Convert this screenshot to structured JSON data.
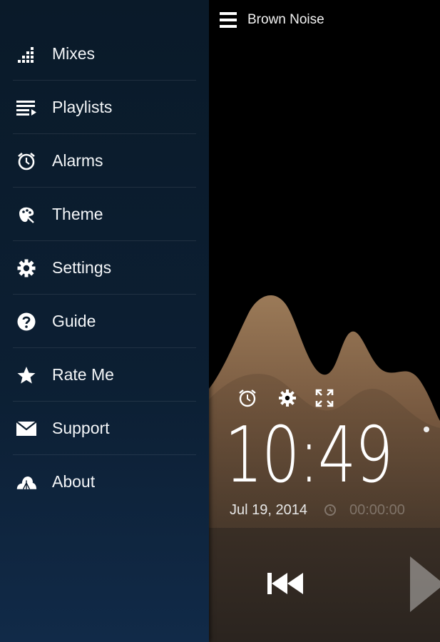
{
  "header": {
    "title": "Brown Noise",
    "menu_icon": "hamburger-icon"
  },
  "drawer": {
    "items": [
      {
        "label": "Mixes",
        "icon": "equalizer-icon"
      },
      {
        "label": "Playlists",
        "icon": "playlist-icon"
      },
      {
        "label": "Alarms",
        "icon": "alarm-clock-icon"
      },
      {
        "label": "Theme",
        "icon": "palette-icon"
      },
      {
        "label": "Settings",
        "icon": "gear-icon"
      },
      {
        "label": "Guide",
        "icon": "help-icon"
      },
      {
        "label": "Rate Me",
        "icon": "star-icon"
      },
      {
        "label": "Support",
        "icon": "envelope-icon"
      },
      {
        "label": "About",
        "icon": "cloud-icon"
      }
    ]
  },
  "player": {
    "time": "10:49",
    "date": "Jul 19, 2014",
    "timer": "00:00:00",
    "controls": [
      "alarm-clock-icon",
      "gear-icon",
      "fullscreen-icon",
      "previous-icon",
      "play-icon"
    ]
  },
  "colors": {
    "drawer_top": "#0a1a29",
    "drawer_bottom": "#112a48",
    "wave": "#8a6a4c",
    "background": "#000000"
  }
}
